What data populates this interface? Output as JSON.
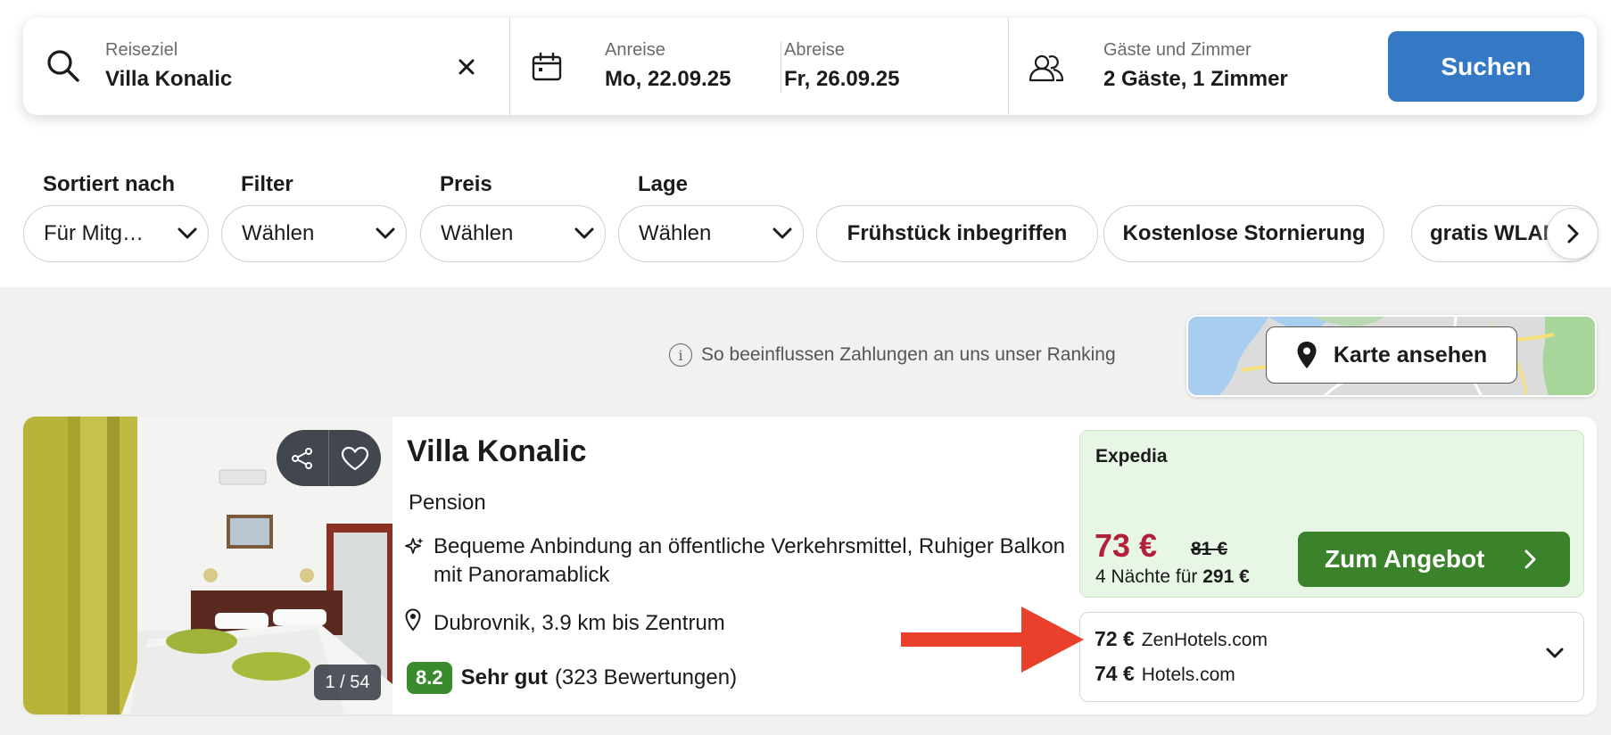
{
  "search": {
    "destination_label": "Reiseziel",
    "destination_value": "Villa Konalic",
    "checkin_label": "Anreise",
    "checkin_value": "Mo, 22.09.25",
    "checkout_label": "Abreise",
    "checkout_value": "Fr, 26.09.25",
    "guests_label": "Gäste und Zimmer",
    "guests_value": "2 Gäste, 1 Zimmer",
    "search_button": "Suchen"
  },
  "filters": {
    "sort_label": "Sortiert nach",
    "sort_value": "Für Mitg…",
    "filter_label": "Filter",
    "filter_value": "Wählen",
    "price_label": "Preis",
    "price_value": "Wählen",
    "location_label": "Lage",
    "location_value": "Wählen",
    "quick": [
      "Frühstück inbegriffen",
      "Kostenlose Stornierung",
      "gratis WLAN"
    ]
  },
  "ranking_info": "So beeinflussen Zahlungen an uns unser Ranking",
  "map_button": "Karte ansehen",
  "hotel": {
    "name": "Villa Konalic",
    "type": "Pension",
    "features": "Bequeme Anbindung an öffentliche Verkehrsmittel, Ruhiger Balkon mit Panoramablick",
    "location": "Dubrovnik, 3.9 km bis Zentrum",
    "rating": "8.2",
    "rating_text": "Sehr gut",
    "reviews": "(323 Bewertungen)",
    "photo_count": "1 / 54"
  },
  "offer": {
    "provider": "Expedia",
    "price": "73 €",
    "old_price": "81 €",
    "nights_prefix": "4 Nächte für",
    "total": "291 €",
    "button": "Zum Angebot"
  },
  "alternatives": [
    {
      "price": "72 €",
      "provider": "ZenHotels.com"
    },
    {
      "price": "74 €",
      "provider": "Hotels.com"
    }
  ],
  "colors": {
    "search_button": "#3578c5",
    "deal_button": "#3a832b",
    "offer_bg": "#e8f6e6",
    "price_red": "#b3203a",
    "rating_green": "#3a8a2e",
    "annotation_arrow": "#e8402b"
  },
  "icons": [
    "search-icon",
    "clear-icon",
    "calendar-icon",
    "guests-icon",
    "chevron-down-icon",
    "chevron-right-icon",
    "info-icon",
    "map-pin-icon",
    "share-icon",
    "heart-icon",
    "sparkle-icon",
    "location-icon"
  ]
}
